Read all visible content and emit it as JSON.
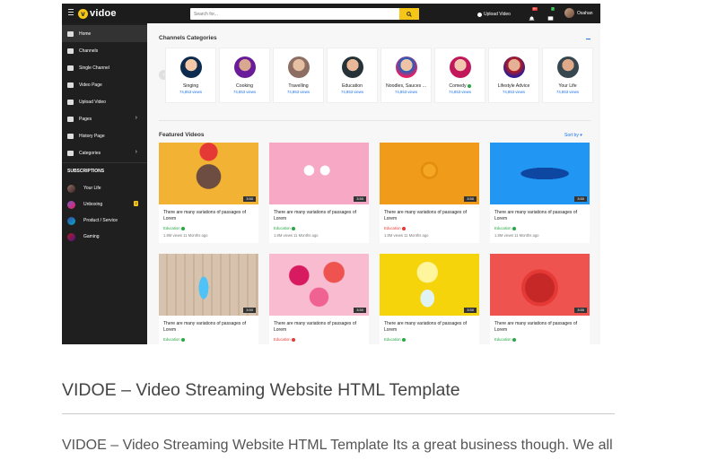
{
  "app": {
    "logo_letter": "v",
    "logo_text": "vidoe"
  },
  "search": {
    "placeholder": "Search for..."
  },
  "topbar": {
    "upload_label": "Upload Video",
    "notifications_count": "9+",
    "messages_count": "7",
    "user_name": "Osahan",
    "accent": "#f5c518"
  },
  "sidebar": {
    "items": [
      {
        "label": "Home",
        "icon": "home-icon"
      },
      {
        "label": "Channels",
        "icon": "users-icon"
      },
      {
        "label": "Single Channel",
        "icon": "user-icon"
      },
      {
        "label": "Video Page",
        "icon": "video-icon"
      },
      {
        "label": "Upload Video",
        "icon": "upload-icon"
      },
      {
        "label": "Pages",
        "icon": "folder-icon"
      },
      {
        "label": "History Page",
        "icon": "history-icon"
      },
      {
        "label": "Categories",
        "icon": "list-icon"
      }
    ],
    "subscriptions_heading": "SUBSCRIPTIONS",
    "subscriptions": [
      {
        "label": "Your Life",
        "count": ""
      },
      {
        "label": "Unboxing",
        "count": "2"
      },
      {
        "label": "Product / Service",
        "count": ""
      },
      {
        "label": "Gaming",
        "count": ""
      }
    ]
  },
  "channels": {
    "title": "Channels Categories",
    "items": [
      {
        "name": "Singing",
        "views": "74,853 views"
      },
      {
        "name": "Cooking",
        "views": "74,853 views"
      },
      {
        "name": "Travelling",
        "views": "74,853 views"
      },
      {
        "name": "Education",
        "views": "74,853 views"
      },
      {
        "name": "Noodles, Sauces ...",
        "views": "74,853 views"
      },
      {
        "name": "Comedy",
        "views": "74,853 views"
      },
      {
        "name": "Lifestyle Advice",
        "views": "74,853 views"
      },
      {
        "name": "Your Life",
        "views": "74,853 views"
      }
    ]
  },
  "featured": {
    "title": "Featured Videos",
    "sort_label": "Sort by",
    "videos": [
      {
        "title": "There are many variations of passages of Lorem",
        "category": "Education",
        "meta": "1.8M views  11 Months ago",
        "duration": "3:50",
        "status": "green"
      },
      {
        "title": "There are many variations of passages of Lorem",
        "category": "Education",
        "meta": "1.8M views  11 Months ago",
        "duration": "3:50",
        "status": "green"
      },
      {
        "title": "There are many variations of passages of Lorem",
        "category": "Education",
        "meta": "1.8M views  11 Months ago",
        "duration": "3:50",
        "status": "red"
      },
      {
        "title": "There are many variations of passages of Lorem",
        "category": "Education",
        "meta": "1.8M views  11 Months ago",
        "duration": "3:50",
        "status": "green"
      },
      {
        "title": "There are many variations of passages of Lorem",
        "category": "Education",
        "meta": "",
        "duration": "3:50",
        "status": "green"
      },
      {
        "title": "There are many variations of passages of Lorem",
        "category": "Education",
        "meta": "",
        "duration": "3:50",
        "status": "red"
      },
      {
        "title": "There are many variations of passages of Lorem",
        "category": "Education",
        "meta": "",
        "duration": "3:50",
        "status": "green"
      },
      {
        "title": "There are many variations of passages of Lorem",
        "category": "Education",
        "meta": "",
        "duration": "3:50",
        "status": "green"
      }
    ]
  },
  "page": {
    "heading": "VIDOE – Video Streaming Website HTML Template",
    "body": "VIDOE – Video Streaming Website HTML Template Its a great business though. We all"
  }
}
